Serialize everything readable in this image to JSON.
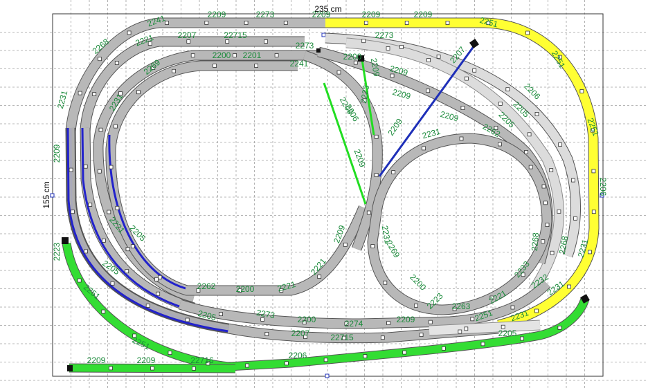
{
  "dimensions": {
    "width": "235 cm",
    "height": "155 cm"
  },
  "colors": {
    "track": "#b8b8b8",
    "track_edge": "#555555",
    "light_track": "#dcdcdc",
    "yellow": "#ffff33",
    "blue": "#2222cc",
    "green": "#33dd33",
    "label": "#1a8a3a",
    "grid": "#a0a0a0"
  },
  "labels": [
    {
      "id": "l1",
      "text": "2209"
    },
    {
      "id": "l2",
      "text": "2273"
    },
    {
      "id": "l3",
      "text": "2209"
    },
    {
      "id": "l4",
      "text": "2209"
    },
    {
      "id": "l5",
      "text": "2241"
    },
    {
      "id": "l6",
      "text": "2209"
    },
    {
      "id": "l7",
      "text": "2207"
    },
    {
      "id": "l8",
      "text": "22715"
    },
    {
      "id": "l9",
      "text": "2251"
    },
    {
      "id": "l10",
      "text": "2268"
    },
    {
      "id": "l11",
      "text": "2221"
    },
    {
      "id": "l12",
      "text": "2273"
    },
    {
      "id": "l13",
      "text": "2200"
    },
    {
      "id": "l14",
      "text": "2201"
    },
    {
      "id": "l15",
      "text": "2273"
    },
    {
      "id": "l16",
      "text": "2241"
    },
    {
      "id": "l17",
      "text": "2269"
    },
    {
      "id": "l18",
      "text": "2200"
    },
    {
      "id": "l19",
      "text": "2209"
    },
    {
      "id": "l20",
      "text": "2209"
    },
    {
      "id": "l21",
      "text": "2207"
    },
    {
      "id": "l22",
      "text": "2251"
    },
    {
      "id": "l23",
      "text": "2231"
    },
    {
      "id": "l24",
      "text": "2231"
    },
    {
      "id": "l25",
      "text": "2209"
    },
    {
      "id": "l26",
      "text": "2209"
    },
    {
      "id": "l27",
      "text": "2206"
    },
    {
      "id": "l28",
      "text": "2231"
    },
    {
      "id": "l29",
      "text": "2209"
    },
    {
      "id": "l30",
      "text": "2205"
    },
    {
      "id": "l31",
      "text": "2205"
    },
    {
      "id": "l32",
      "text": "2262"
    },
    {
      "id": "l33",
      "text": "2251"
    },
    {
      "id": "l34",
      "text": "2209"
    },
    {
      "id": "l35",
      "text": "2209"
    },
    {
      "id": "l36",
      "text": "2206"
    },
    {
      "id": "l37",
      "text": "2205"
    },
    {
      "id": "l38",
      "text": "2221"
    },
    {
      "id": "l39",
      "text": "2268"
    },
    {
      "id": "l40",
      "text": "2268"
    },
    {
      "id": "l41",
      "text": "2231"
    },
    {
      "id": "l42",
      "text": "2223"
    },
    {
      "id": "l43",
      "text": "2205"
    },
    {
      "id": "l44",
      "text": "2221"
    },
    {
      "id": "l45",
      "text": "2262"
    },
    {
      "id": "l46",
      "text": "2200"
    },
    {
      "id": "l47",
      "text": "2221"
    },
    {
      "id": "l48",
      "text": "2269"
    },
    {
      "id": "l49",
      "text": "2200"
    },
    {
      "id": "l50",
      "text": "2223"
    },
    {
      "id": "l51",
      "text": "2263"
    },
    {
      "id": "l52",
      "text": "2221"
    },
    {
      "id": "l53",
      "text": "2233"
    },
    {
      "id": "l54",
      "text": "2232"
    },
    {
      "id": "l55",
      "text": "2231"
    },
    {
      "id": "l56",
      "text": "2231"
    },
    {
      "id": "l57",
      "text": "2251"
    },
    {
      "id": "l58",
      "text": "2205"
    },
    {
      "id": "l59",
      "text": "2209"
    },
    {
      "id": "l60",
      "text": "2274"
    },
    {
      "id": "l61",
      "text": "2200"
    },
    {
      "id": "l62",
      "text": "2273"
    },
    {
      "id": "l63",
      "text": "2207"
    },
    {
      "id": "l64",
      "text": "22715"
    },
    {
      "id": "l65",
      "text": "2205"
    },
    {
      "id": "l66",
      "text": "2251"
    },
    {
      "id": "l67",
      "text": "2251"
    },
    {
      "id": "l68",
      "text": "2209"
    },
    {
      "id": "l69",
      "text": "2209"
    },
    {
      "id": "l70",
      "text": "22716"
    },
    {
      "id": "l71",
      "text": "2206"
    },
    {
      "id": "l72",
      "text": "2223"
    },
    {
      "id": "l73",
      "text": "2209"
    },
    {
      "id": "l74",
      "text": "2206"
    },
    {
      "id": "l75",
      "text": "2209"
    },
    {
      "id": "l76",
      "text": "2231"
    }
  ]
}
